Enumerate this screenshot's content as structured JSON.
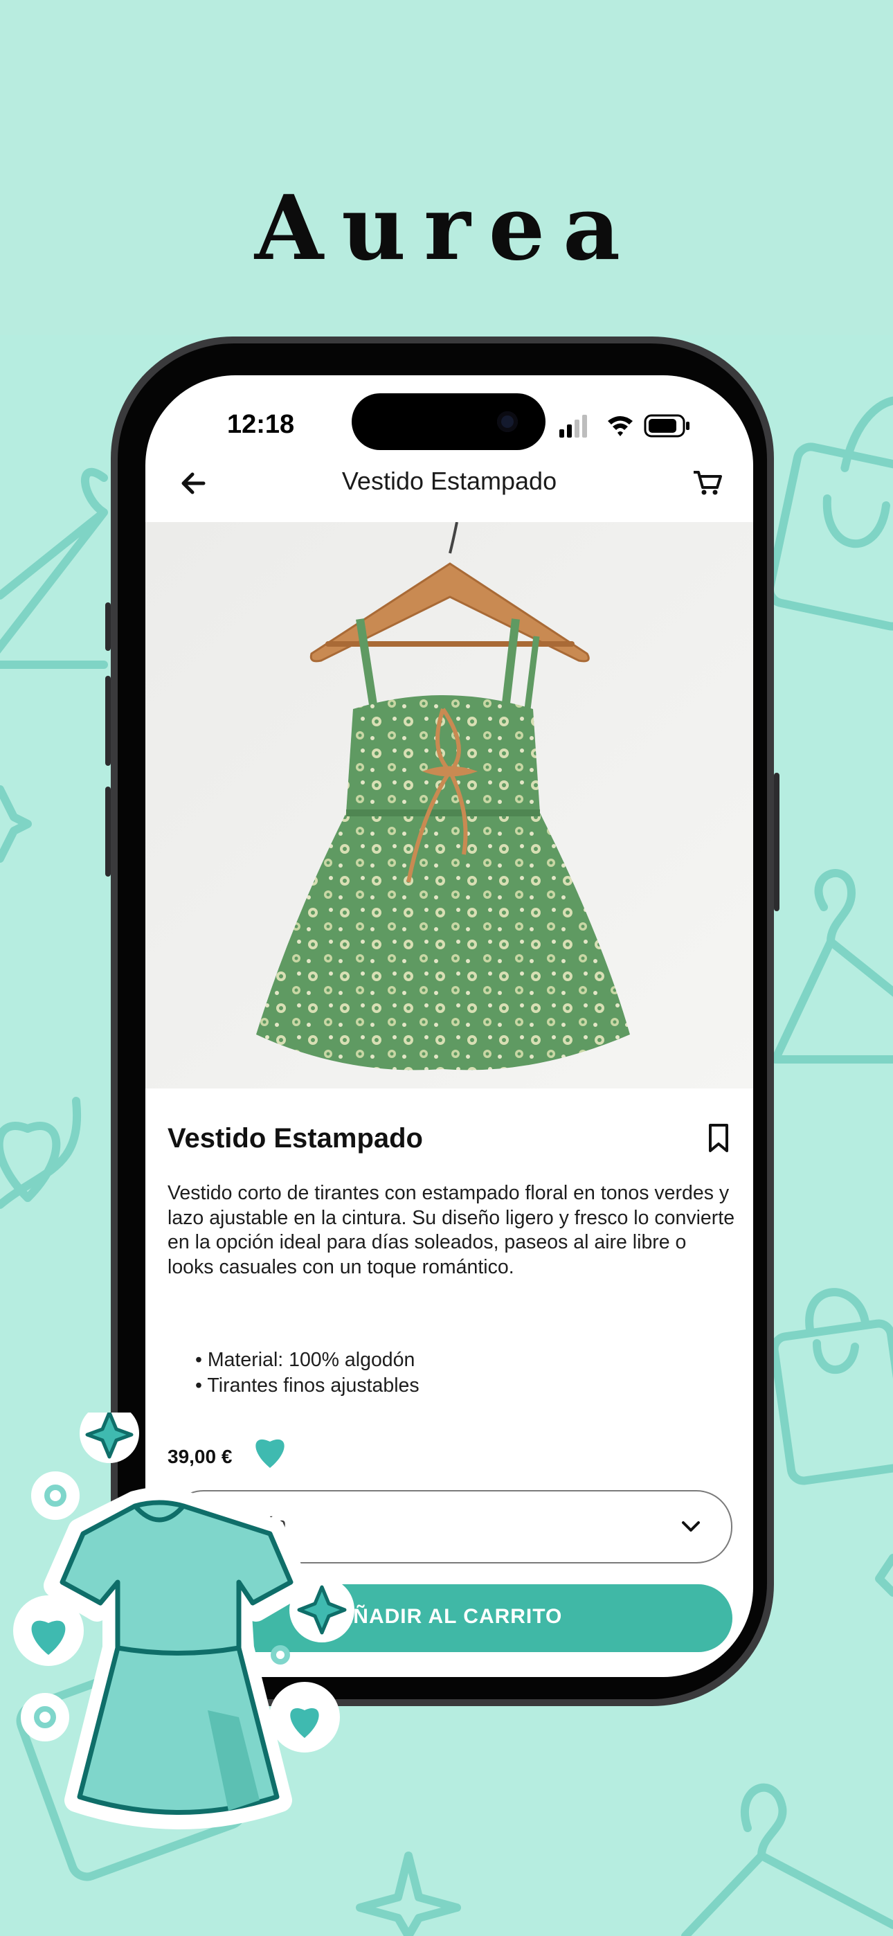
{
  "brand": "Aurea",
  "status": {
    "time": "12:18"
  },
  "topbar": {
    "title": "Vestido Estampado"
  },
  "product": {
    "title": "Vestido Estampado",
    "description": "Vestido corto de tirantes con estampado floral en tonos verdes y lazo ajustable en la cintura. Su diseño ligero y fresco lo convierte en la opción ideal para días soleados, paseos al aire libre o looks casuales con un toque romántico.",
    "features": [
      "Material: 100% algodón",
      "Tirantes finos ajustables"
    ],
    "price": "39,00 €",
    "option_placeholder": "a opción",
    "cart_button": "AÑADIR AL CARRITO"
  },
  "colors": {
    "background": "#b6ede0",
    "accent": "#40b8a6",
    "pattern": "#78cfc0",
    "sticker_dress": "#7fd6cb"
  },
  "icons": [
    "back-arrow-icon",
    "cart-icon",
    "bookmark-icon",
    "chevron-down-icon",
    "signal-icon",
    "wifi-icon",
    "battery-icon"
  ]
}
